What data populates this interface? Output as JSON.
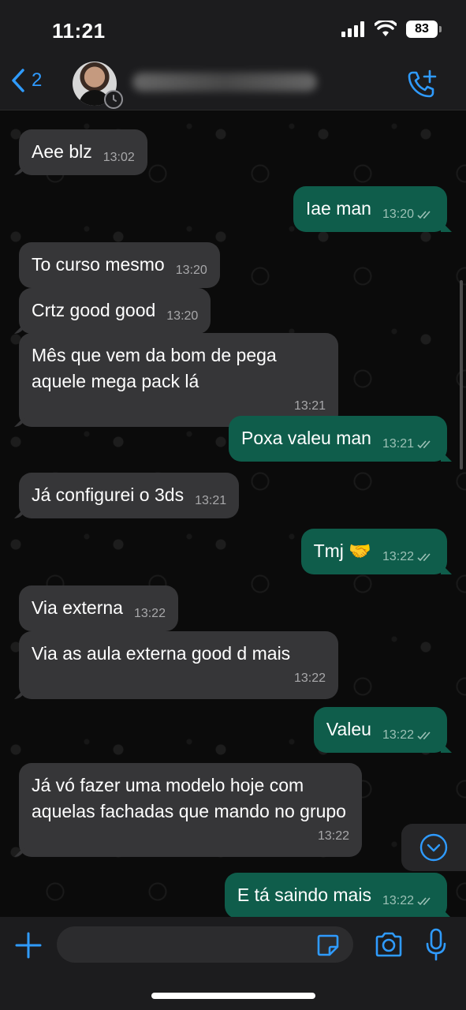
{
  "status_bar": {
    "time": "11:21",
    "battery": "83"
  },
  "header": {
    "back_count": "2",
    "contact_name_hidden": true,
    "icons": [
      "chevron-left-icon",
      "add-call-icon"
    ]
  },
  "messages": [
    {
      "dir": "in",
      "text": "Aee blz",
      "time": "13:02"
    },
    {
      "dir": "out",
      "text": "Iae man",
      "time": "13:20"
    },
    {
      "dir": "in",
      "text": "To curso mesmo",
      "time": "13:20"
    },
    {
      "dir": "in",
      "text": "Crtz good good",
      "time": "13:20"
    },
    {
      "dir": "in",
      "text": "Mês que vem da bom de pega aquele mega pack lá",
      "time": "13:21"
    },
    {
      "dir": "out",
      "text": "Poxa valeu man",
      "time": "13:21"
    },
    {
      "dir": "in",
      "text": "Já configurei o 3ds",
      "time": "13:21"
    },
    {
      "dir": "out",
      "text": "Tmj 🤝",
      "time": "13:22"
    },
    {
      "dir": "in",
      "text": "Via externa",
      "time": "13:22"
    },
    {
      "dir": "in",
      "text": "Via as aula externa good d mais",
      "time": "13:22"
    },
    {
      "dir": "out",
      "text": "Valeu",
      "time": "13:22"
    },
    {
      "dir": "in",
      "text": "Já vó fazer uma modelo hoje com aquelas fachadas que mando no grupo",
      "time": "13:22"
    },
    {
      "dir": "out",
      "text": "E tá saindo mais",
      "time": "13:22"
    }
  ],
  "input": {
    "placeholder": "",
    "value": ""
  },
  "colors": {
    "incoming_bubble": "#363638",
    "outgoing_bubble": "#0f5d4b",
    "accent": "#2f9bff"
  }
}
